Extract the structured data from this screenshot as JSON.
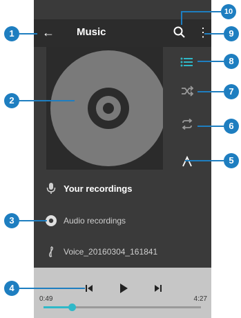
{
  "app": {
    "title": "Music"
  },
  "list": {
    "header": "Your recordings",
    "items": [
      {
        "label": "Audio recordings"
      },
      {
        "label": "Voice_20160304_161841"
      }
    ]
  },
  "player": {
    "elapsed": "0:49",
    "total": "4:27",
    "progress": 0.18
  },
  "callouts": [
    "1",
    "2",
    "3",
    "4",
    "5",
    "6",
    "7",
    "8",
    "9",
    "10"
  ],
  "colors": {
    "accent": "#2fb8c8",
    "callout": "#1e7ec0"
  },
  "icons": {
    "back": "arrow-left-icon",
    "search": "search-icon",
    "more": "more-vertical-icon",
    "list": "list-icon",
    "shuffle": "shuffle-icon",
    "repeat": "repeat-icon",
    "collapse": "chevron-up-icon"
  }
}
